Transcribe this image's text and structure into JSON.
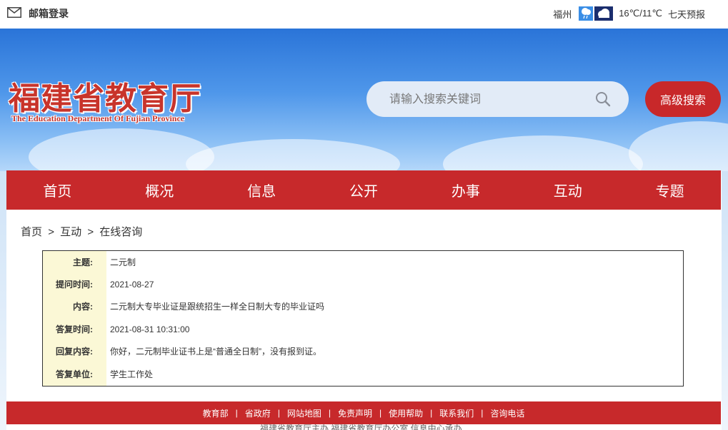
{
  "topbar": {
    "mail_label": "邮箱登录",
    "weather": {
      "city": "福州",
      "temp": "16℃/11℃",
      "forecast_link": "七天预报",
      "icon1": "rain-icon",
      "icon2": "cloud-icon"
    }
  },
  "banner": {
    "logo_main": "福建省教育厅",
    "logo_sub": "The Education Department Of Fujian Province",
    "search_placeholder": "请输入搜索关键词",
    "advanced_search": "高级搜索",
    "brand_color": "#c7292b"
  },
  "nav": {
    "items": [
      "首页",
      "概况",
      "信息",
      "公开",
      "办事",
      "互动",
      "专题"
    ]
  },
  "breadcrumb": {
    "home": "首页",
    "sep1": ">",
    "section": "互动",
    "sep2": ">",
    "current": "在线咨询"
  },
  "detail": {
    "rows": [
      {
        "label": "主题:",
        "value": "二元制"
      },
      {
        "label": "提问时间:",
        "value": "2021-08-27"
      },
      {
        "label": "内容:",
        "value": "二元制大专毕业证是跟统招生一样全日制大专的毕业证吗"
      },
      {
        "label": "答复时间:",
        "value": "2021-08-31 10:31:00"
      },
      {
        "label": "回复内容:",
        "value": "你好，二元制毕业证书上是“普通全日制”，没有报到证。"
      },
      {
        "label": "答复单位:",
        "value": "学生工作处"
      }
    ]
  },
  "footer": {
    "links": [
      "教育部",
      "省政府",
      "网站地图",
      "免责声明",
      "使用帮助",
      "联系我们",
      "咨询电话"
    ],
    "separator": "|",
    "bottom_text": "福建省教育厅主办    福建省教育厅办公室    信息中心承办"
  }
}
